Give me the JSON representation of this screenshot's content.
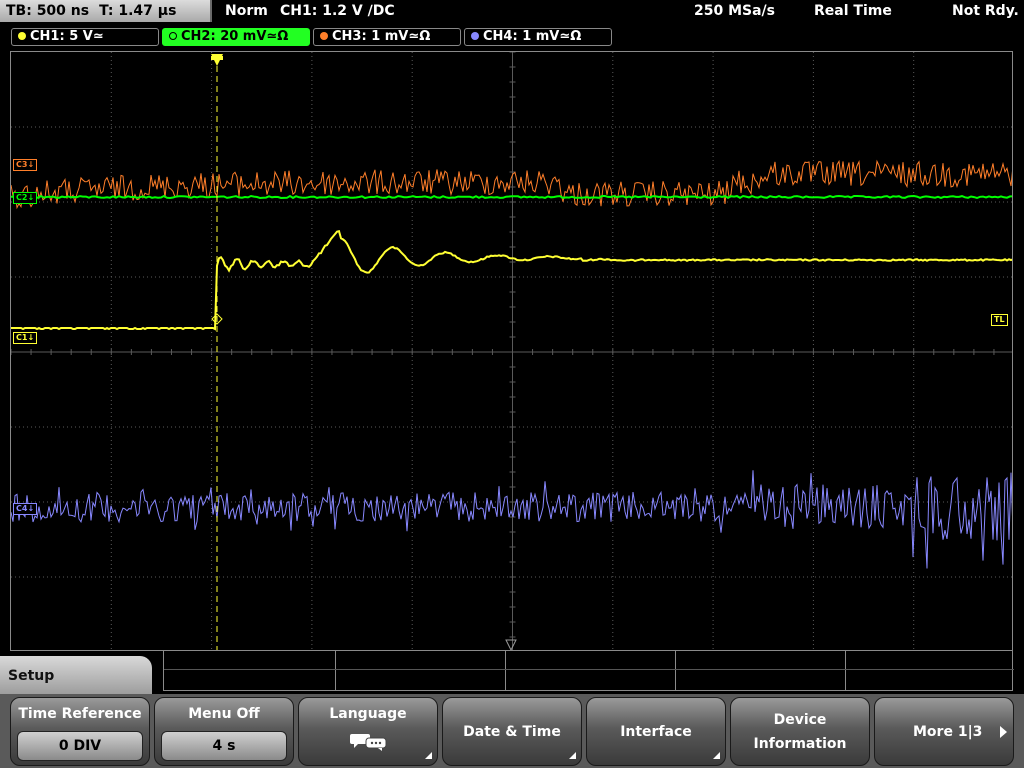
{
  "status": {
    "timebase": "TB: 500 ns",
    "trigger_time": "T: 1.47 µs",
    "trigger_mode": "Norm",
    "trigger_source": "CH1: 1.2 V ∕DC",
    "sample_rate": "250 MSa/s",
    "acq_mode": "Real Time",
    "state": "Not Rdy."
  },
  "channels": [
    {
      "label": "CH1: 5 V≃",
      "color": "#ffff33"
    },
    {
      "label": "CH2: 20 mV≃Ω",
      "color": "#00ff00"
    },
    {
      "label": "CH3: 1 mV≃Ω",
      "color": "#ff7f2a"
    },
    {
      "label": "CH4: 1 mV≃Ω",
      "color": "#8888ff"
    }
  ],
  "markers": {
    "ch1": "C1↓",
    "ch2": "C2↓",
    "ch3": "C3↓",
    "ch4": "C4↓",
    "trigger_level": "TL"
  },
  "menu": {
    "title": "Setup",
    "keys": [
      {
        "label": "Time Reference",
        "value": "0 DIV"
      },
      {
        "label": "Menu Off",
        "value": "4 s"
      },
      {
        "label": "Language",
        "icon": "speech-bubble-icon"
      },
      {
        "label": "Date & Time"
      },
      {
        "label": "Interface"
      },
      {
        "label_line1": "Device",
        "label_line2": "Information"
      },
      {
        "label": "More 1|3"
      }
    ]
  },
  "colors": {
    "ch1": "#ffff33",
    "ch2": "#00ff00",
    "ch3": "#ff7f2a",
    "ch4": "#8888ff",
    "grid": "#606060",
    "tab_active": "#22ff22"
  }
}
